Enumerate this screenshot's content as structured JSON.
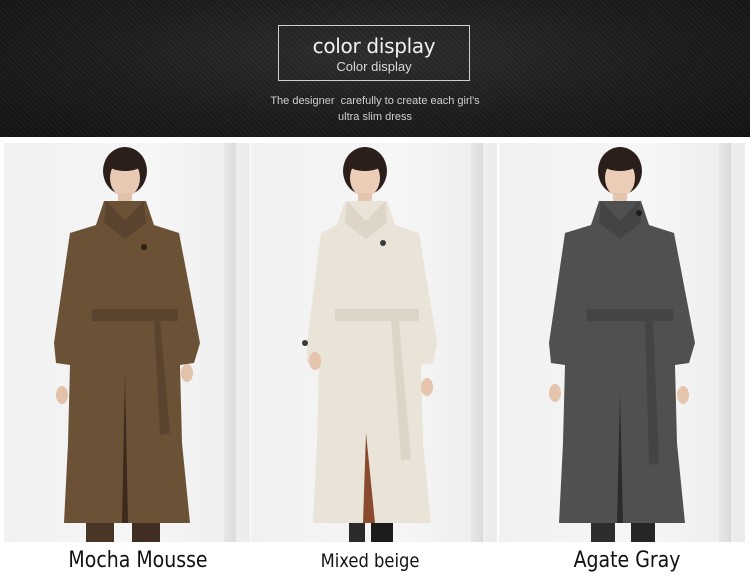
{
  "header": {
    "title": "color display",
    "subtitle": "Color display",
    "tagline_line1": "The designer  carefully to create each girl's",
    "tagline_line2": "ultra slim dress"
  },
  "colors": {
    "banner_bg": "#1b1b1b",
    "mocha": "#6b5236",
    "beige": "#e9e3d8",
    "gray": "#505050"
  },
  "swatches": [
    {
      "label": "Mocha Mousse",
      "coat_color": "#6b5236",
      "icon": "coat-photo"
    },
    {
      "label": "Mixed beige",
      "coat_color": "#e9e3d8",
      "icon": "coat-photo"
    },
    {
      "label": "Agate Gray",
      "coat_color": "#505050",
      "icon": "coat-photo"
    }
  ]
}
